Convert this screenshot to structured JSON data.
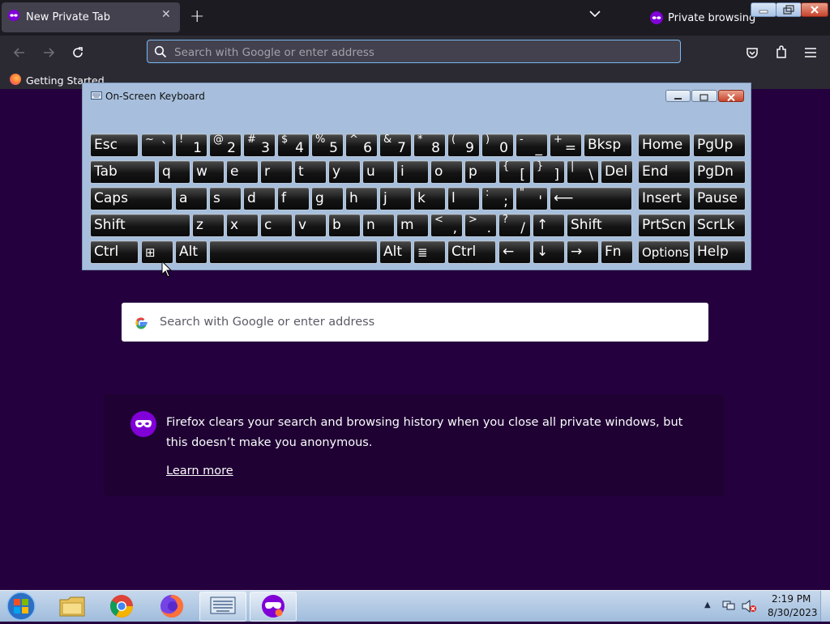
{
  "browser": {
    "tab": {
      "title": "New Private Tab",
      "close_glyph": "✕",
      "icon": "private-mask-icon"
    },
    "new_tab_glyph": "+",
    "private_indicator": {
      "label": "Private browsing",
      "icon": "private-mask-icon"
    },
    "urlbar": {
      "placeholder": "Search with Google or enter address"
    },
    "bookmarks": [
      {
        "label": "Getting Started",
        "icon": "firefox-icon"
      }
    ],
    "toolbar_icons": [
      "back-icon",
      "forward-icon",
      "reload-icon",
      "pocket-icon",
      "extensions-icon",
      "menu-icon"
    ]
  },
  "osk": {
    "title": "On-Screen Keyboard",
    "rows": [
      [
        {
          "main": "Esc"
        },
        {
          "sup": "~",
          "sub": "`"
        },
        {
          "sup": "!",
          "sub": "1"
        },
        {
          "sup": "@",
          "sub": "2"
        },
        {
          "sup": "#",
          "sub": "3"
        },
        {
          "sup": "$",
          "sub": "4"
        },
        {
          "sup": "%",
          "sub": "5"
        },
        {
          "sup": "^",
          "sub": "6"
        },
        {
          "sup": "&",
          "sub": "7"
        },
        {
          "sup": "*",
          "sub": "8"
        },
        {
          "sup": "(",
          "sub": "9"
        },
        {
          "sup": ")",
          "sub": "0"
        },
        {
          "sup": "-",
          "sub": "_"
        },
        {
          "sup": "+",
          "sub": "="
        },
        {
          "main": "Bksp"
        },
        {
          "main": "Home"
        },
        {
          "main": "PgUp"
        }
      ],
      [
        {
          "main": "Tab"
        },
        {
          "main": "q"
        },
        {
          "main": "w"
        },
        {
          "main": "e"
        },
        {
          "main": "r"
        },
        {
          "main": "t"
        },
        {
          "main": "y"
        },
        {
          "main": "u"
        },
        {
          "main": "i"
        },
        {
          "main": "o"
        },
        {
          "main": "p"
        },
        {
          "sup": "{",
          "sub": "["
        },
        {
          "sup": "}",
          "sub": "]"
        },
        {
          "sup": "|",
          "sub": "\\"
        },
        {
          "main": "Del"
        },
        {
          "main": "End"
        },
        {
          "main": "PgDn"
        }
      ],
      [
        {
          "main": "Caps"
        },
        {
          "main": "a"
        },
        {
          "main": "s"
        },
        {
          "main": "d"
        },
        {
          "main": "f"
        },
        {
          "main": "g"
        },
        {
          "main": "h"
        },
        {
          "main": "j"
        },
        {
          "main": "k"
        },
        {
          "main": "l"
        },
        {
          "sup": ":",
          "sub": ";"
        },
        {
          "sup": "\"",
          "sub": "'"
        },
        {
          "main": "⟵"
        },
        {
          "main": "Insert"
        },
        {
          "main": "Pause"
        }
      ],
      [
        {
          "main": "Shift"
        },
        {
          "main": "z"
        },
        {
          "main": "x"
        },
        {
          "main": "c"
        },
        {
          "main": "v"
        },
        {
          "main": "b"
        },
        {
          "main": "n"
        },
        {
          "main": "m"
        },
        {
          "sup": "<",
          "sub": ","
        },
        {
          "sup": ">",
          "sub": "."
        },
        {
          "sup": "?",
          "sub": "/"
        },
        {
          "main": "↑"
        },
        {
          "main": "Shift"
        },
        {
          "main": "PrtScn"
        },
        {
          "main": "ScrLk"
        }
      ],
      [
        {
          "main": "Ctrl"
        },
        {
          "main": "⊞"
        },
        {
          "main": "Alt"
        },
        {
          "main": ""
        },
        {
          "main": "Alt"
        },
        {
          "main": "≣"
        },
        {
          "main": "Ctrl"
        },
        {
          "main": "←"
        },
        {
          "main": "↓"
        },
        {
          "main": "→"
        },
        {
          "main": "Fn"
        },
        {
          "main": "Options"
        },
        {
          "main": "Help"
        }
      ]
    ]
  },
  "content": {
    "search_placeholder": "Search with Google or enter address",
    "info_text": "Firefox clears your search and browsing history when you close all private windows, but this doesn’t make you anonymous.",
    "learn_more": "Learn more"
  },
  "taskbar": {
    "apps": [
      "start-orb",
      "file-explorer-icon",
      "chrome-icon",
      "firefox-icon",
      "on-screen-keyboard-icon",
      "firefox-private-icon"
    ],
    "time": "2:19 PM",
    "date": "8/30/2023"
  }
}
